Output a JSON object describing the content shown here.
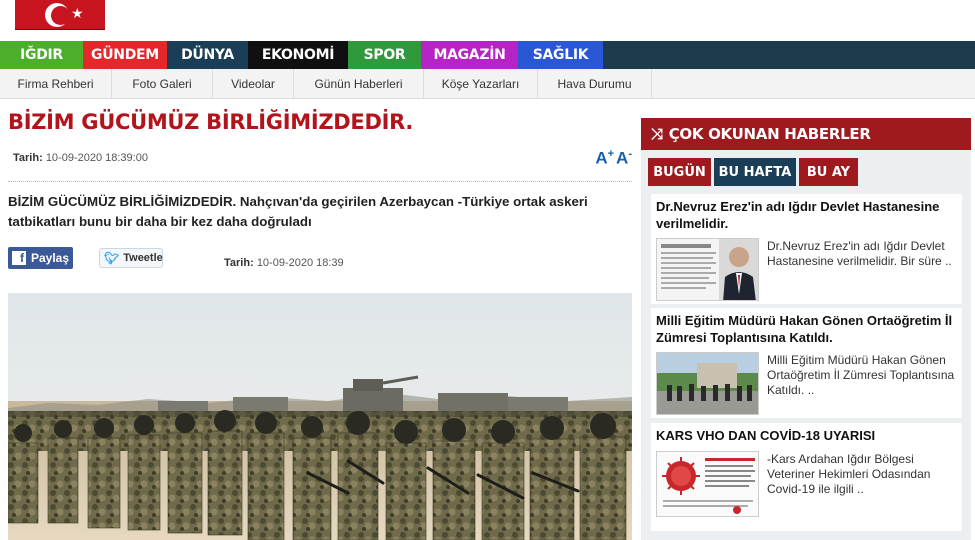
{
  "nav": {
    "main": [
      {
        "label": "IĞDIR",
        "color": "#4caf2c"
      },
      {
        "label": "GÜNDEM",
        "color": "#e3282b"
      },
      {
        "label": "DÜNYA",
        "color": "#1a3e58"
      },
      {
        "label": "EKONOMİ",
        "color": "#101010"
      },
      {
        "label": "SPOR",
        "color": "#2f9a3c"
      },
      {
        "label": "MAGAZİN",
        "color": "#b624c5"
      },
      {
        "label": "SAĞLIK",
        "color": "#2a58d4"
      }
    ],
    "sub": [
      "Firma Rehberi",
      "Foto Galeri",
      "Videolar",
      "Günün Haberleri",
      "Köşe Yazarları",
      "Hava Durumu"
    ]
  },
  "article": {
    "title": "BİZİM GÜCÜMÜZ BİRLİĞİMİZDEDİR.",
    "date_label": "Tarih:",
    "date": "10-09-2020 18:39:00",
    "font_controls": {
      "increase": "A",
      "decrease": "A",
      "plus": "+",
      "minus": "-"
    },
    "lead": "BİZİM GÜCÜMÜZ BİRLİĞİMİZDEDİR. Nahçıvan'da geçirilen Azerbaycan -Türkiye ortak askeri tatbikatları bunu bir daha bir kez daha doğruladı",
    "share_facebook": "Paylaş",
    "share_twitter": "Tweetle",
    "date2_label": "Tarih:",
    "date2": "10-09-2020 18:39"
  },
  "sidebar": {
    "heading": "ÇOK OKUNAN HABERLER",
    "tabs": [
      {
        "label": "BUGÜN",
        "color": "#9e1a1e"
      },
      {
        "label": "BU HAFTA",
        "color": "#1a3e58"
      },
      {
        "label": "BU AY",
        "color": "#9e1a1e"
      }
    ],
    "cards": [
      {
        "title": "Dr.Nevruz Erez'in adı Iğdır Devlet Hastanesine verilmelidir.",
        "summary": "Dr.Nevruz Erez'in adı Iğdır Devlet Hastanesine verilmelidir. Bir süre .."
      },
      {
        "title": "Milli Eğitim Müdürü Hakan Gönen Ortaöğretim İl Zümresi Toplantısına Katıldı.",
        "summary": "Milli Eğitim Müdürü Hakan Gönen Ortaöğretim İl Zümresi Toplantısına Katıldı. .."
      },
      {
        "title": "KARS VHO DAN COVİD-18 UYARISI",
        "summary": "-Kars Ardahan Iğdır Bölgesi Veteriner Hekimleri Odasından Covid-19 ile ilgili .."
      }
    ]
  }
}
